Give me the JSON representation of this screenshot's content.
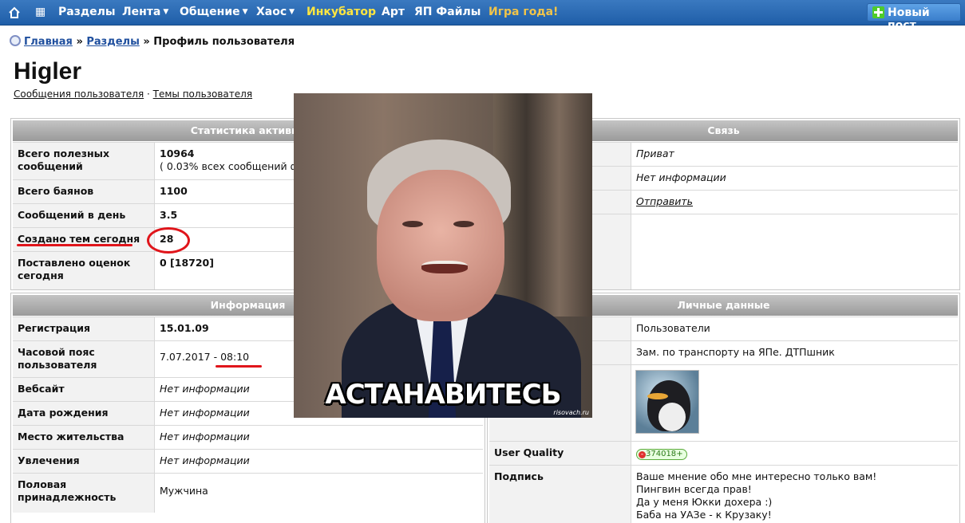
{
  "nav": {
    "items": [
      "Разделы",
      "Лента",
      "Общение",
      "Хаос",
      "Инкубатор",
      "Арт",
      "ЯП Файлы",
      "Игра года!"
    ],
    "new_post": "Новый пост"
  },
  "breadcrumb": {
    "home": "Главная",
    "sep": "»",
    "sections": "Разделы",
    "current": "Профиль пользователя"
  },
  "user": {
    "name": "Higler",
    "link_posts": "Сообщения пользователя",
    "dot": "·",
    "link_topics": "Темы пользователя"
  },
  "stats": {
    "title": "Статистика активно",
    "rows": [
      {
        "k": "Всего полезных сообщений",
        "v": "10964",
        "v2": "( 0.03% всех сообщений ф"
      },
      {
        "k": "Всего баянов",
        "v": "1100"
      },
      {
        "k": "Сообщений в день",
        "v": "3.5"
      },
      {
        "k": "Создано тем сегодня",
        "v": "28"
      },
      {
        "k": "Поставлено оценок сегодня",
        "v": "0 [18720]"
      }
    ]
  },
  "contact": {
    "title": "Связь",
    "rows": [
      {
        "v": "Приват"
      },
      {
        "v": "Нет информации"
      },
      {
        "v": "Отправить"
      }
    ]
  },
  "info": {
    "title": "Информация",
    "rows": [
      {
        "k": "Регистрация",
        "v": "15.01.09"
      },
      {
        "k": "Часовой пояс пользователя",
        "v": "7.07.2017 - 08:10"
      },
      {
        "k": "Вебсайт",
        "v": "Нет информации"
      },
      {
        "k": "Дата рождения",
        "v": "Нет информации"
      },
      {
        "k": "Место жительства",
        "v": "Нет информации"
      },
      {
        "k": "Увлечения",
        "v": "Нет информации"
      },
      {
        "k": "Половая принадлежность",
        "v": "Мужчина"
      }
    ]
  },
  "personal": {
    "title": "Личные данные",
    "group": "Пользователи",
    "status": "Зам. по транспорту на ЯПе. ДТПшник",
    "uq_label": "User Quality",
    "uq_value": "374018",
    "sig_label": "Подпись",
    "signature": [
      "Ваше мнение обо мне интересно только вам!",
      "Пингвин всегда прав!",
      "Да у меня Юкки дохера :)",
      "Баба на УАЗе - к Крузаку!"
    ]
  },
  "meme": {
    "caption": "АСТАНАВИТЕСЬ",
    "watermark": "risovach.ru"
  },
  "colors": {
    "nav_bg": "#2a6ab4",
    "annotation_red": "#e0151b",
    "incubator": "#ffe640"
  }
}
